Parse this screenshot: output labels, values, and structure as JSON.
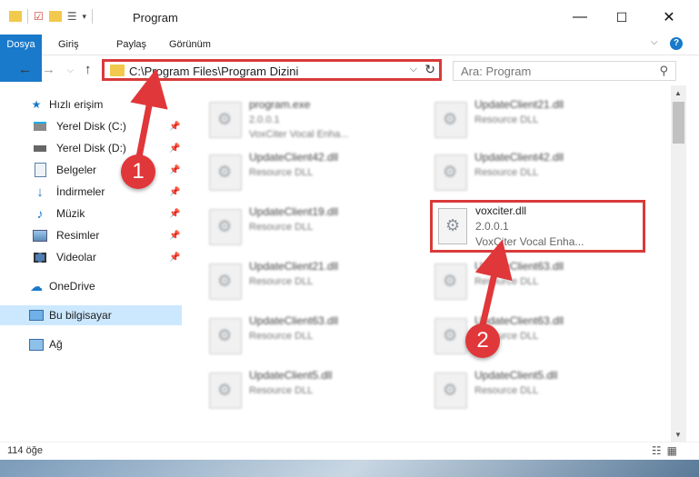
{
  "window": {
    "title": "Program",
    "controls": {
      "minimize": "—",
      "maximize": "☐",
      "close": "✕"
    }
  },
  "ribbon": {
    "tabs": [
      {
        "label": "Dosya"
      },
      {
        "label": "Giriş"
      },
      {
        "label": "Paylaş"
      },
      {
        "label": "Görünüm"
      }
    ],
    "help": "?"
  },
  "nav": {
    "path": "C:\\Program Files\\Program Dizini",
    "search_placeholder": "Ara: Program"
  },
  "sidebar": {
    "quick_access": "Hızlı erişim",
    "items": [
      {
        "label": "Yerel Disk (C:)",
        "icon": "drive-icon"
      },
      {
        "label": "Yerel Disk (D:)",
        "icon": "drive-icon"
      },
      {
        "label": "Belgeler",
        "icon": "documents-icon"
      },
      {
        "label": "İndirmeler",
        "icon": "download-icon"
      },
      {
        "label": "Müzik",
        "icon": "music-icon"
      },
      {
        "label": "Resimler",
        "icon": "pictures-icon"
      },
      {
        "label": "Videolar",
        "icon": "videos-icon"
      }
    ],
    "onedrive": "OneDrive",
    "this_pc": "Bu bilgisayar",
    "network": "Ağ"
  },
  "files": {
    "left": [
      {
        "name": "program.exe",
        "line1": "2.0.0.1",
        "line2": "VoxCiter Vocal Enha..."
      },
      {
        "name": "UpdateClient42.dll",
        "line1": "Resource DLL",
        "line2": ""
      },
      {
        "name": "UpdateClient19.dll",
        "line1": "Resource DLL",
        "line2": ""
      },
      {
        "name": "UpdateClient21.dll",
        "line1": "Resource DLL",
        "line2": ""
      },
      {
        "name": "UpdateClient63.dll",
        "line1": "Resource DLL",
        "line2": ""
      },
      {
        "name": "UpdateClient5.dll",
        "line1": "Resource DLL",
        "line2": ""
      }
    ],
    "right": [
      {
        "name": "UpdateClient21.dll",
        "line1": "Resource DLL"
      },
      {
        "name": "UpdateClient42.dll",
        "line1": "Resource DLL"
      },
      {
        "name": "UpdateClient63.dll",
        "line1": "Resource DLL"
      },
      {
        "name": "UpdateClient63.dll",
        "line1": "Resource DLL"
      },
      {
        "name": "UpdateClient5.dll",
        "line1": "Resource DLL"
      }
    ],
    "highlighted": {
      "name": "voxciter.dll",
      "version": "2.0.0.1",
      "description": "VoxCiter Vocal Enha..."
    }
  },
  "annotations": {
    "badge1": "1",
    "badge2": "2",
    "color": "#e0373a"
  },
  "status": {
    "count": "114 öğe"
  }
}
